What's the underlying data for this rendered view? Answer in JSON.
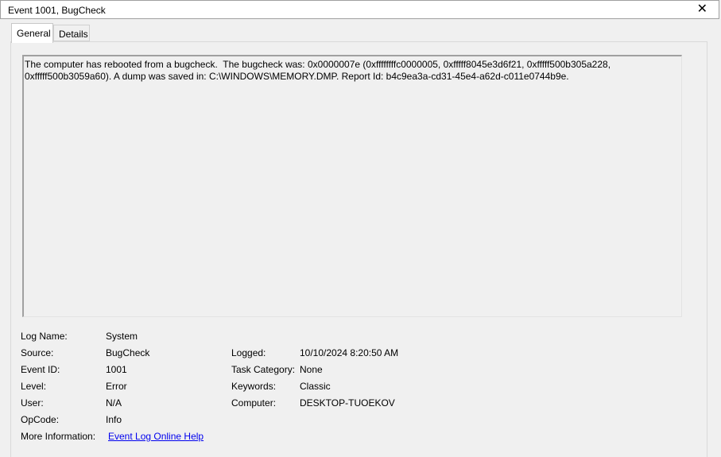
{
  "window": {
    "title": "Event 1001, BugCheck",
    "close_glyph": "✕"
  },
  "tabs": [
    {
      "label": "General"
    },
    {
      "label": "Details"
    }
  ],
  "description": "The computer has rebooted from a bugcheck.  The bugcheck was: 0x0000007e (0xffffffffc0000005, 0xfffff8045e3d6f21, 0xfffff500b305a228,\n0xfffff500b3059a60). A dump was saved in: C:\\WINDOWS\\MEMORY.DMP. Report Id: b4c9ea3a-cd31-45e4-a62d-c011e0744b9e.",
  "fields": {
    "log_name": {
      "label": "Log Name:",
      "value": "System"
    },
    "source": {
      "label": "Source:",
      "value": "BugCheck"
    },
    "event_id": {
      "label": "Event ID:",
      "value": "1001"
    },
    "level": {
      "label": "Level:",
      "value": "Error"
    },
    "user": {
      "label": "User:",
      "value": "N/A"
    },
    "opcode": {
      "label": "OpCode:",
      "value": "Info"
    },
    "more_info": {
      "label": "More Information:",
      "value": "Event Log Online Help"
    },
    "logged": {
      "label": "Logged:",
      "value": "10/10/2024 8:20:50 AM"
    },
    "task_category": {
      "label": "Task Category:",
      "value": "None"
    },
    "keywords": {
      "label": "Keywords:",
      "value": "Classic"
    },
    "computer": {
      "label": "Computer:",
      "value": "DESKTOP-TUOEKOV"
    }
  }
}
